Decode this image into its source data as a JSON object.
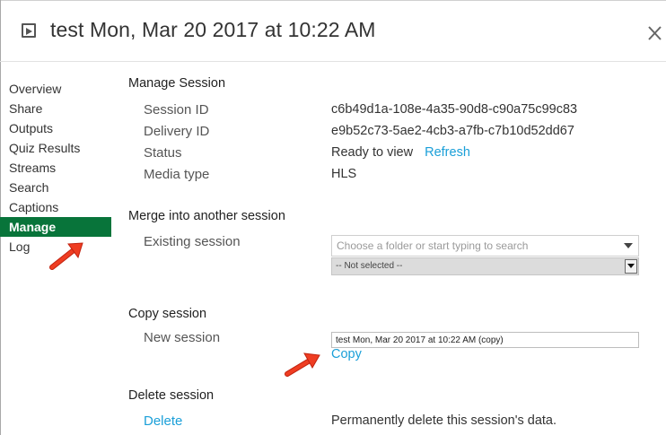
{
  "header": {
    "title": "test Mon, Mar 20 2017 at 10:22 AM",
    "play_icon": "play-icon",
    "close_glyph": "×"
  },
  "nav": {
    "items": [
      {
        "label": "Overview"
      },
      {
        "label": "Share"
      },
      {
        "label": "Outputs"
      },
      {
        "label": "Quiz Results"
      },
      {
        "label": "Streams"
      },
      {
        "label": "Search"
      },
      {
        "label": "Captions"
      },
      {
        "label": "Manage",
        "active": true
      },
      {
        "label": "Log"
      }
    ]
  },
  "manage": {
    "title": "Manage Session",
    "session_id_label": "Session ID",
    "session_id": "c6b49d1a-108e-4a35-90d8-c90a75c99c83",
    "delivery_id_label": "Delivery ID",
    "delivery_id": "e9b52c73-5ae2-4cb3-a7fb-c7b10d52dd67",
    "status_label": "Status",
    "status": "Ready to view",
    "refresh_label": "Refresh",
    "media_type_label": "Media type",
    "media_type": "HLS"
  },
  "merge": {
    "title": "Merge into another session",
    "existing_label": "Existing session",
    "search_placeholder": "Choose a folder or start typing to search",
    "select_value": "-- Not selected --"
  },
  "copy": {
    "title": "Copy session",
    "new_label": "New session",
    "new_value": "test Mon, Mar 20 2017 at 10:22 AM (copy)",
    "copy_label": "Copy"
  },
  "delete": {
    "title": "Delete session",
    "delete_label": "Delete",
    "description": "Permanently delete this session's data."
  },
  "colors": {
    "accent_green": "#08743a",
    "link_blue": "#1a9fd8",
    "annotation_red": "#e8341c"
  }
}
